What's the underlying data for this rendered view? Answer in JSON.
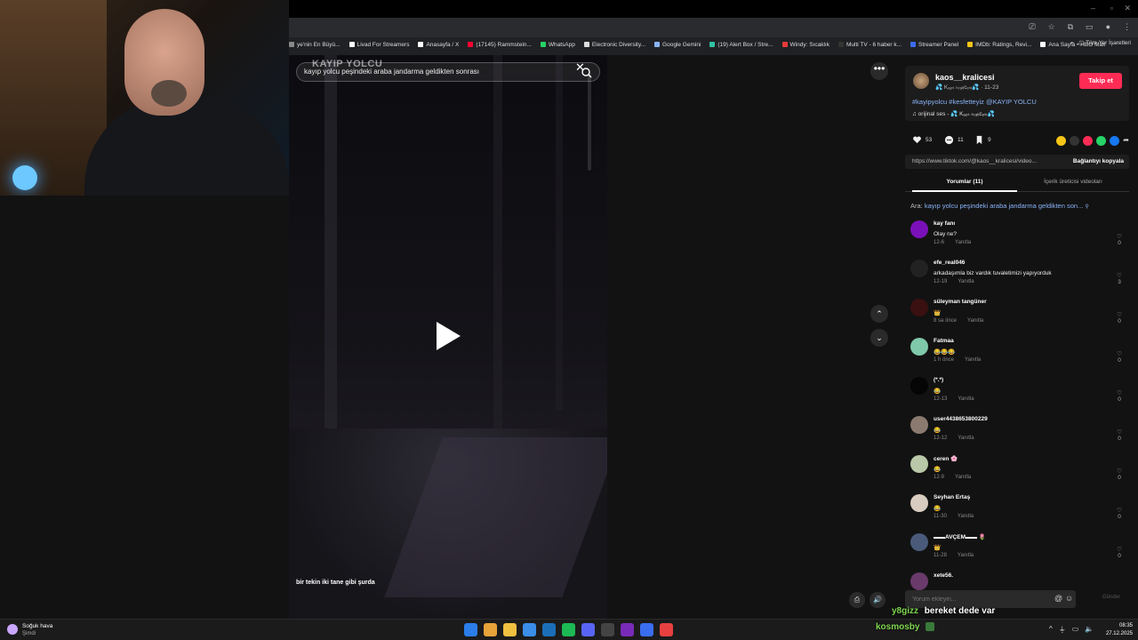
{
  "browser": {
    "bookmarks": [
      {
        "label": "ye'nin En Büyü...",
        "icon": "globe-icon",
        "color": "#888888"
      },
      {
        "label": "Livad For Streamers",
        "icon": "livad-icon",
        "color": "#ffffff"
      },
      {
        "label": "Anasayfa / X",
        "icon": "x-icon",
        "color": "#ffffff"
      },
      {
        "label": "(17145) Rammstein...",
        "icon": "youtube-icon",
        "color": "#ff0033"
      },
      {
        "label": "WhatsApp",
        "icon": "whatsapp-icon",
        "color": "#25d366"
      },
      {
        "label": "Electronic Diversity...",
        "icon": "page-icon",
        "color": "#dddddd"
      },
      {
        "label": "Google Gemini",
        "icon": "gemini-icon",
        "color": "#8ab4f8"
      },
      {
        "label": "(19) Alert Box / Stre...",
        "icon": "streamlabs-icon",
        "color": "#31c3a2"
      },
      {
        "label": "Windy: Sıcaklık",
        "icon": "windy-icon",
        "color": "#e83a3a"
      },
      {
        "label": "Multi TV - 6 haber k...",
        "icon": "tv-icon",
        "color": "#333333"
      },
      {
        "label": "Streamer Panel",
        "icon": "panel-icon",
        "color": "#3a6df0"
      },
      {
        "label": "IMDb: Ratings, Revi...",
        "icon": "imdb-icon",
        "color": "#f5c518"
      },
      {
        "label": "Ana Sayfa • HBO Max",
        "icon": "hbo-icon",
        "color": "#ffffff"
      }
    ],
    "all_bookmarks": "Tüm Yer İşaretleri"
  },
  "video": {
    "watermark": "KAYIP YOLCU",
    "search_query": "kayıp yolcu peşindeki araba jandarma geldikten sonrası",
    "subtitle": "bir tekin iki tane gibi şurda"
  },
  "author": {
    "username": "kaos__kralicesi",
    "display": "💦 Kₐₒₛ ₖᵣₐₗᵢcₑₛᵢ💦 · 11-23",
    "follow_label": "Takip et",
    "hashtags": "#kayipyolcu #kesfetteyiz @KAYIP YOLCU",
    "music": "♫  orijinal ses - 💦 Kₐₒₛ ₖᵣₐₗᵢcₑₛᵢ💦"
  },
  "actions": {
    "likes": "53",
    "comments": "11",
    "saves": "9"
  },
  "share_colors": [
    "#f5c518",
    "#333333",
    "#fe2c55",
    "#25d366",
    "#1877f2"
  ],
  "link": {
    "url": "https://www.tiktok.com/@kaos__kralicesi/video...",
    "copy_label": "Bağlantıyı kopyala"
  },
  "tabs": {
    "comments": "Yorumlar (11)",
    "creator_videos": "İçerik üreticisi videoları"
  },
  "related_search": {
    "prefix": "Ara:",
    "query": "kayıp yolcu peşindeki araba jandarma geldikten son..."
  },
  "reply_label": "Yanıtla",
  "comments": [
    {
      "name": "kay fanı",
      "text": "Olay ne?",
      "date": "12-6",
      "likes": "0",
      "avatar": "#7a10b8"
    },
    {
      "name": "efe_real046",
      "text": "arkadaşımla biz vardık tuvaletimizi yapıyorduk",
      "date": "12-19",
      "likes": "3",
      "avatar": "#222222"
    },
    {
      "name": "süleyman tangüner",
      "text": "👑",
      "date": "8 sa önce",
      "likes": "0",
      "avatar": "#3a1010"
    },
    {
      "name": "Fatmaa",
      "text": "😂😂😂",
      "date": "1 h önce",
      "likes": "0",
      "avatar": "#7fc8a9"
    },
    {
      "name": "(*.*)",
      "text": "😂",
      "date": "12-13",
      "likes": "0",
      "avatar": "#050505"
    },
    {
      "name": "user4438653800229",
      "text": "😂",
      "date": "12-12",
      "likes": "0",
      "avatar": "#8a7a70"
    },
    {
      "name": "ceren 🌸",
      "text": "😂",
      "date": "12-9",
      "likes": "0",
      "avatar": "#b8c8a8"
    },
    {
      "name": "Seyhan Ertaş",
      "text": "😂",
      "date": "11-30",
      "likes": "0",
      "avatar": "#d8ccc0"
    },
    {
      "name": "▬▬AVÇEM▬▬ 🌷",
      "text": "👑",
      "date": "11-28",
      "likes": "0",
      "avatar": "#4a5a7a"
    },
    {
      "name": "xete56.",
      "text": "",
      "date": "",
      "likes": "",
      "avatar": "#6a3a6a"
    }
  ],
  "comment_input": {
    "placeholder": "Yorum ekleyin...",
    "post_label": "Gönder"
  },
  "chat": [
    {
      "user": "y8gizz",
      "message": "bereket dede var",
      "color": "#7fd650"
    },
    {
      "user": "kosmosby",
      "message": "",
      "color": "#7fd650"
    }
  ],
  "taskbar": {
    "weather_title": "Soğuk hava",
    "weather_sub": "Şimdi",
    "time": "08:35",
    "date": "27.12.2025",
    "apps": [
      "#2b7de9",
      "#e8a33a",
      "#f0c040",
      "#3a8ee8",
      "#1b6fb8",
      "#1db954",
      "#5865f2",
      "#444444",
      "#7a2ab8",
      "#3a6df0",
      "#e84040"
    ]
  }
}
